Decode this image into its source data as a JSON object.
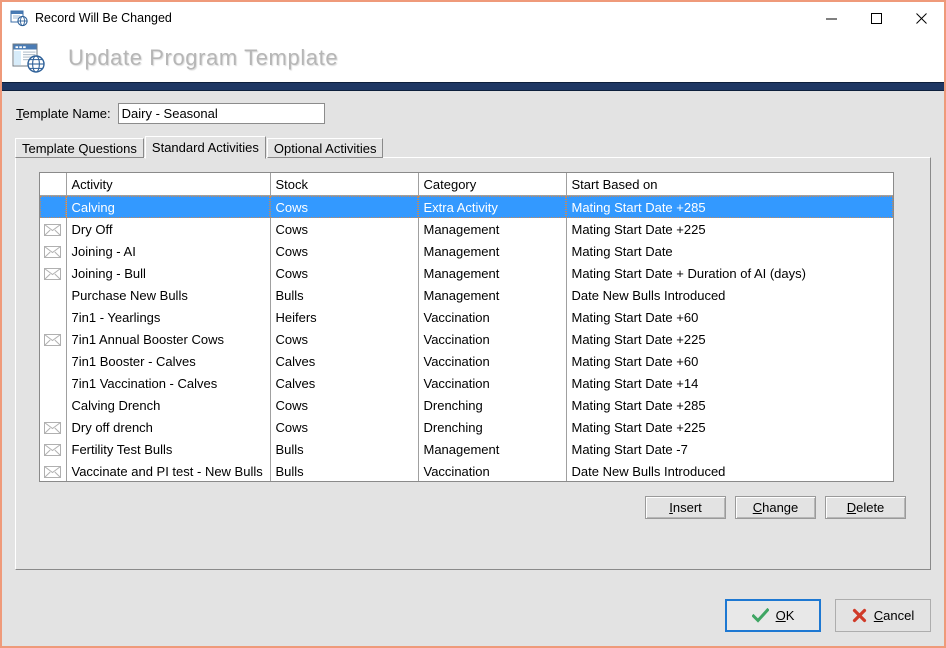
{
  "window": {
    "title": "Record Will Be Changed",
    "title_icon": "window-globe-icon",
    "banner_title": "Update Program Template",
    "banner_icon": "window-globe-icon",
    "minimize_label": "—",
    "maximize_label": "□",
    "close_label": "✕",
    "border_color": "#ef9a7a",
    "rule_color": "#1f3864"
  },
  "form": {
    "template_name_label": "Template Name:",
    "template_name_accelerator": "T",
    "template_name_value": "Dairy - Seasonal",
    "template_name_placeholder": ""
  },
  "tabs": [
    {
      "label": "Template Questions",
      "active": false
    },
    {
      "label": "Standard Activities",
      "active": true
    },
    {
      "label": "Optional Activities",
      "active": false
    }
  ],
  "grid": {
    "columns": [
      "",
      "Activity",
      "Stock",
      "Category",
      "Start Based on"
    ],
    "selected_index": 0,
    "rows": [
      {
        "icon": "",
        "activity": "Calving",
        "stock": "Cows",
        "category": "Extra Activity",
        "start_based_on": "Mating Start Date +285",
        "selected": true
      },
      {
        "icon": "envelope-icon",
        "activity": "Dry Off",
        "stock": "Cows",
        "category": "Management",
        "start_based_on": "Mating Start Date +225",
        "selected": false
      },
      {
        "icon": "envelope-icon",
        "activity": "Joining - AI",
        "stock": "Cows",
        "category": "Management",
        "start_based_on": "Mating Start Date",
        "selected": false
      },
      {
        "icon": "envelope-icon",
        "activity": "Joining - Bull",
        "stock": "Cows",
        "category": "Management",
        "start_based_on": "Mating Start Date + Duration of AI (days)",
        "selected": false
      },
      {
        "icon": "",
        "activity": "Purchase New Bulls",
        "stock": "Bulls",
        "category": "Management",
        "start_based_on": "Date New Bulls Introduced",
        "selected": false
      },
      {
        "icon": "",
        "activity": "7in1 - Yearlings",
        "stock": "Heifers",
        "category": "Vaccination",
        "start_based_on": "Mating Start Date +60",
        "selected": false
      },
      {
        "icon": "envelope-icon",
        "activity": "7in1 Annual Booster Cows",
        "stock": "Cows",
        "category": "Vaccination",
        "start_based_on": "Mating Start Date +225",
        "selected": false
      },
      {
        "icon": "",
        "activity": "7in1 Booster - Calves",
        "stock": "Calves",
        "category": "Vaccination",
        "start_based_on": "Mating Start Date +60",
        "selected": false
      },
      {
        "icon": "",
        "activity": "7in1 Vaccination - Calves",
        "stock": "Calves",
        "category": "Vaccination",
        "start_based_on": "Mating Start Date +14",
        "selected": false
      },
      {
        "icon": "",
        "activity": "Calving Drench",
        "stock": "Cows",
        "category": "Drenching",
        "start_based_on": "Mating Start Date +285",
        "selected": false
      },
      {
        "icon": "envelope-icon",
        "activity": "Dry off drench",
        "stock": "Cows",
        "category": "Drenching",
        "start_based_on": "Mating Start Date +225",
        "selected": false
      },
      {
        "icon": "envelope-icon",
        "activity": "Fertility Test  Bulls",
        "stock": "Bulls",
        "category": "Management",
        "start_based_on": "Mating Start Date -7",
        "selected": false
      },
      {
        "icon": "envelope-icon",
        "activity": "Vaccinate and PI test  - New Bulls",
        "stock": "Bulls",
        "category": "Vaccination",
        "start_based_on": "Date New Bulls Introduced",
        "selected": false
      }
    ]
  },
  "grid_buttons": [
    {
      "label": "Insert",
      "accelerator": "I"
    },
    {
      "label": "Change",
      "accelerator": "C"
    },
    {
      "label": "Delete",
      "accelerator": "D"
    }
  ],
  "footer": {
    "ok": {
      "label": "OK",
      "accelerator": "O",
      "icon": "check-icon",
      "icon_color": "#3fa563",
      "is_default": true
    },
    "cancel": {
      "label": "Cancel",
      "accelerator": "C",
      "icon": "cross-icon",
      "icon_color": "#d03a28",
      "is_default": false
    }
  }
}
